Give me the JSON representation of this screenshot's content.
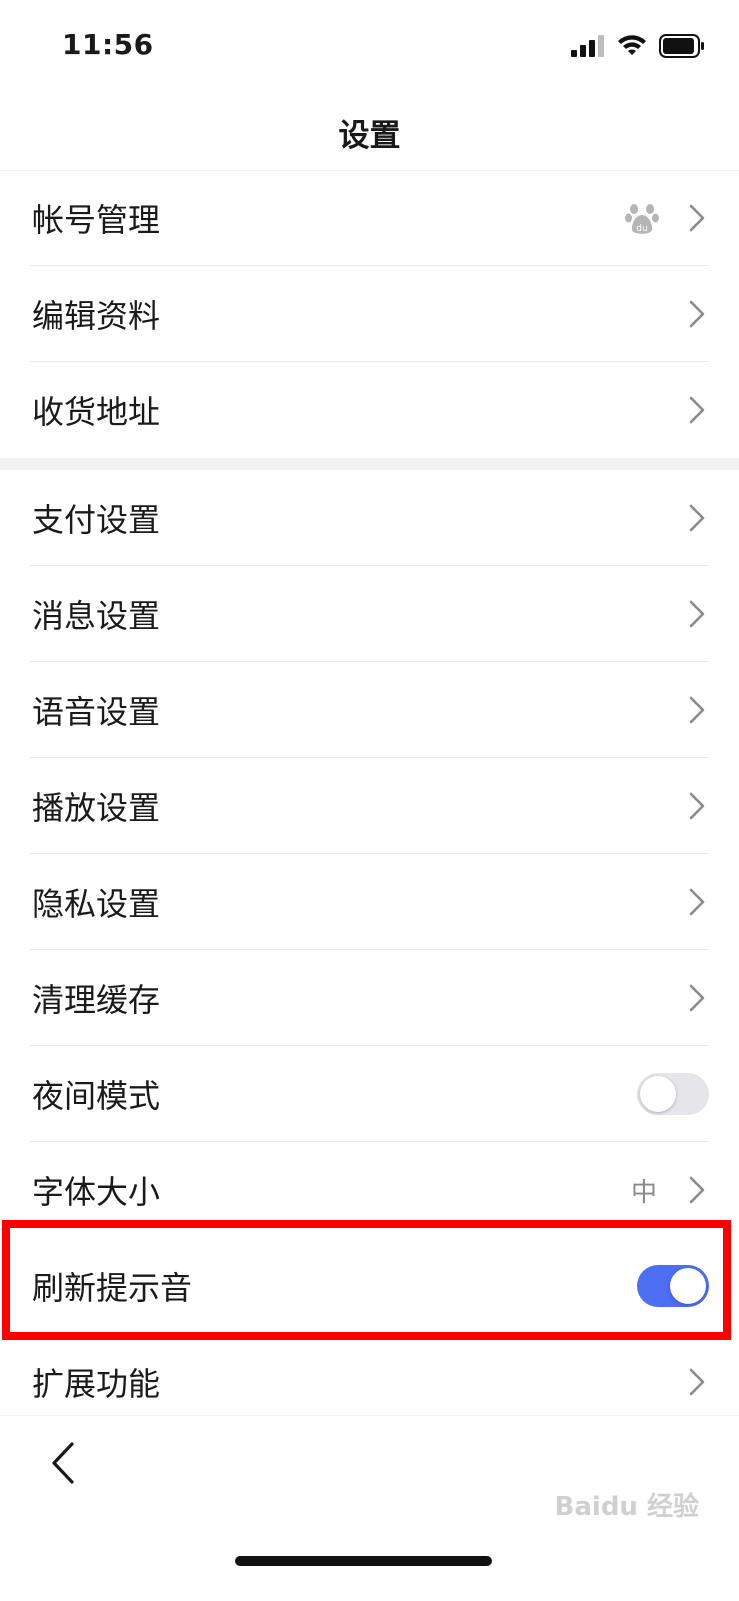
{
  "status": {
    "time": "11:56"
  },
  "header": {
    "title": "设置"
  },
  "group1": [
    {
      "label": "帐号管理",
      "icon": "baidu-paw-icon"
    },
    {
      "label": "编辑资料"
    },
    {
      "label": "收货地址"
    }
  ],
  "group2": [
    {
      "label": "支付设置"
    },
    {
      "label": "消息设置"
    },
    {
      "label": "语音设置"
    },
    {
      "label": "播放设置"
    },
    {
      "label": "隐私设置"
    },
    {
      "label": "清理缓存"
    },
    {
      "label": "夜间模式",
      "toggle": false
    },
    {
      "label": "字体大小",
      "value": "中"
    },
    {
      "label": "刷新提示音",
      "toggle": true
    },
    {
      "label": "扩展功能"
    }
  ],
  "colors": {
    "accent": "#4e6ef2",
    "highlight": "#ff0000"
  },
  "watermark": "Baidu 经验"
}
